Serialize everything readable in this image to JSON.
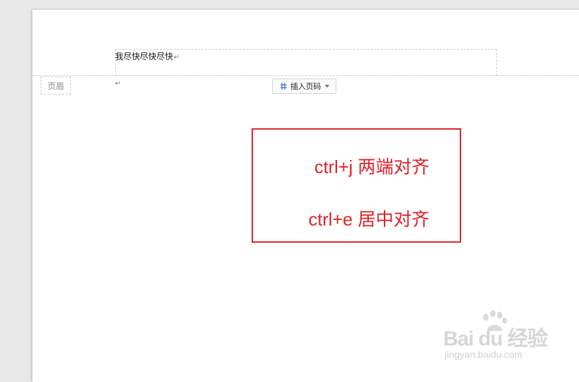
{
  "document": {
    "header_text": "我尽快尽快尽快",
    "paragraph_mark": "↵",
    "header_label": "页眉",
    "insert_page_number_button": "插入页码"
  },
  "annotation": {
    "line1": "ctrl+j 两端对齐",
    "line2": "ctrl+e 居中对齐",
    "border_color": "#e0202a"
  },
  "watermark": {
    "brand": "Bai du 经验",
    "url": "jingyan.baidu.com",
    "icon": "baidu-paw-icon"
  }
}
